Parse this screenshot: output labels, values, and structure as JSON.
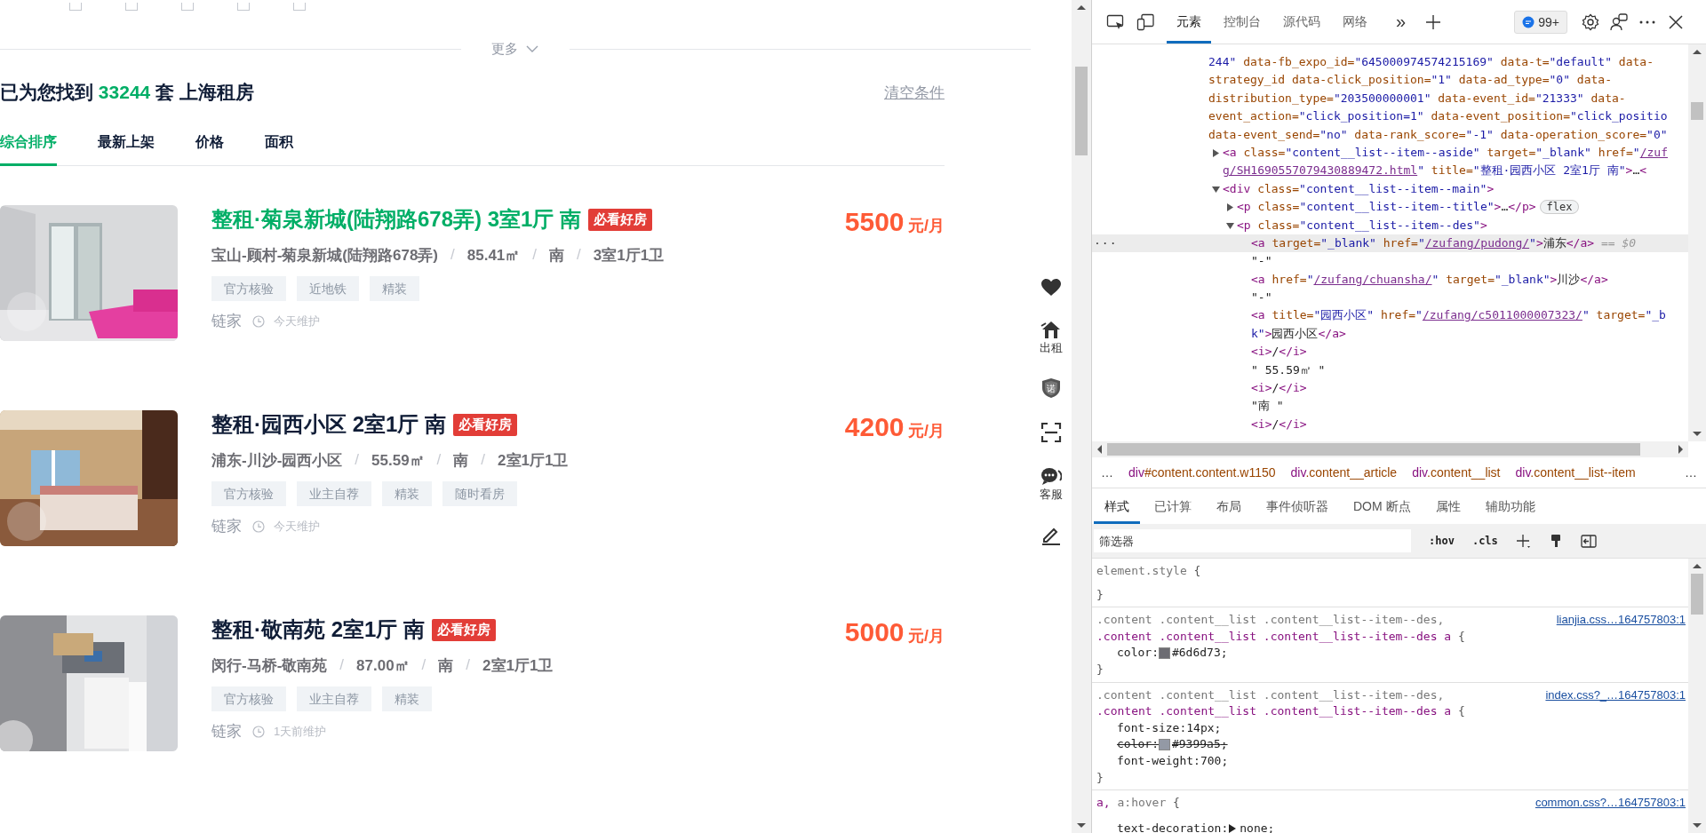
{
  "filters": [
    {
      "checked": false
    },
    {
      "checked": false
    },
    {
      "checked": false
    },
    {
      "checked": false
    },
    {
      "checked": false
    }
  ],
  "more": {
    "label": "更多"
  },
  "summary": {
    "prefix": "已为您找到",
    "count": "33244",
    "suffix": "套 上海租房"
  },
  "clear": "清空条件",
  "sort_tabs": [
    {
      "label": "综合排序",
      "selected": true
    },
    {
      "label": "最新上架",
      "selected": false
    },
    {
      "label": "价格",
      "selected": false
    },
    {
      "label": "面积",
      "selected": false
    }
  ],
  "listings": [
    {
      "picture": {
        "kind": "picture"
      },
      "title": "整租·菊泉新城(陆翔路678弄) 3室1厅 南",
      "highlighted": true,
      "badge": "必看好房",
      "price": "5500",
      "unit": "元/月",
      "details": [
        "宝山-顾村-菊泉新城(陆翔路678弄)",
        "/",
        "85.41㎡",
        "/",
        "南",
        "/",
        "3室1厅1卫"
      ],
      "tags": [
        "官方核验",
        "近地铁",
        "精装"
      ],
      "brand": "链家",
      "updated": "今天维护"
    },
    {
      "picture": {
        "kind": "picture"
      },
      "title": "整租·园西小区 2室1厅 南",
      "highlighted": false,
      "badge": "必看好房",
      "price": "4200",
      "unit": "元/月",
      "details": [
        "浦东-川沙-园西小区",
        "/",
        "55.59㎡",
        "/",
        "南",
        "/",
        "2室1厅1卫"
      ],
      "tags": [
        "官方核验",
        "业主自荐",
        "精装",
        "随时看房"
      ],
      "brand": "链家",
      "updated": "今天维护"
    },
    {
      "picture": {
        "kind": "picture"
      },
      "title": "整租·敬南苑 2室1厅 南",
      "highlighted": false,
      "badge": "必看好房",
      "price": "5000",
      "unit": "元/月",
      "details": [
        "闵行-马桥-敬南苑",
        "/",
        "87.00㎡",
        "/",
        "南",
        "/",
        "2室1厅1卫"
      ],
      "tags": [
        "官方核验",
        "业主自荐",
        "精装"
      ],
      "brand": "链家",
      "updated": "1天前维护"
    }
  ],
  "side_tools": [
    {
      "kind": "heart"
    },
    {
      "kind": "rent",
      "label": "出租"
    },
    {
      "kind": "shield",
      "glyph": "诺"
    },
    {
      "kind": "scan"
    },
    {
      "kind": "chat",
      "label": "客服"
    },
    {
      "kind": "pencil"
    }
  ],
  "devtools": {
    "tabs": [
      {
        "label": "元素",
        "selected": true
      },
      {
        "label": "控制台",
        "selected": false
      },
      {
        "label": "源代码",
        "selected": false
      },
      {
        "label": "网络",
        "selected": false
      }
    ],
    "overflow": "»",
    "issues": "99+",
    "dom": {
      "selected": false,
      "lines": [
        [
          {
            "kind": "value",
            "text": "244\""
          },
          {
            "kind": "attr",
            "text": " data-fb_expo_id="
          },
          {
            "kind": "value",
            "text": "\"645000974574215169\""
          },
          {
            "kind": "attr",
            "text": " data-t="
          },
          {
            "kind": "value",
            "text": "\"default\""
          },
          {
            "kind": "attr",
            "text": " data-"
          }
        ],
        [
          {
            "kind": "attr",
            "text": "strategy_id data-click_position="
          },
          {
            "kind": "value",
            "text": "\"1\""
          },
          {
            "kind": "attr",
            "text": " data-ad_type="
          },
          {
            "kind": "value",
            "text": "\"0\""
          },
          {
            "kind": "attr",
            "text": " data-"
          }
        ],
        [
          {
            "kind": "attr",
            "text": "distribution_type="
          },
          {
            "kind": "value",
            "text": "\"203500000001\""
          },
          {
            "kind": "attr",
            "text": " data-event_id="
          },
          {
            "kind": "value",
            "text": "\"21333\""
          },
          {
            "kind": "attr",
            "text": " data-"
          }
        ],
        [
          {
            "kind": "attr",
            "text": "event_action="
          },
          {
            "kind": "value",
            "text": "\"click_position=1\""
          },
          {
            "kind": "attr",
            "text": " data-event_position="
          },
          {
            "kind": "value",
            "text": "\"click_positio"
          }
        ],
        [
          {
            "kind": "attr",
            "text": "data-event_send="
          },
          {
            "kind": "value",
            "text": "\"no\""
          },
          {
            "kind": "attr",
            "text": " data-rank_score="
          },
          {
            "kind": "value",
            "text": "\"-1\""
          },
          {
            "kind": "attr",
            "text": " data-operation_score="
          },
          {
            "kind": "value",
            "text": "\"0\""
          }
        ]
      ],
      "children": [
        {
          "expanded": false,
          "selected": false,
          "lines": [
            [
              {
                "kind": "tag",
                "text": "<a "
              },
              {
                "kind": "attr",
                "text": "class="
              },
              {
                "kind": "value",
                "text": "\"content__list--item--aside\""
              },
              {
                "kind": "attr",
                "text": " target="
              },
              {
                "kind": "value",
                "text": "\"_blank\""
              },
              {
                "kind": "attr",
                "text": " href="
              },
              {
                "kind": "value",
                "text": "\""
              },
              {
                "kind": "link",
                "text": "/zuf"
              }
            ],
            [
              {
                "kind": "link",
                "text": "g/SH1690557079430889472.html"
              },
              {
                "kind": "value",
                "text": "\""
              },
              {
                "kind": "attr",
                "text": " title="
              },
              {
                "kind": "value",
                "text": "\"整租·园西小区 2室1厅 南\""
              },
              {
                "kind": "tag",
                "text": ">"
              },
              {
                "kind": "text",
                "text": "…"
              },
              {
                "kind": "tag",
                "text": "<"
              }
            ]
          ]
        },
        {
          "expanded": true,
          "selected": false,
          "lines": [
            [
              {
                "kind": "tag",
                "text": "<div "
              },
              {
                "kind": "attr",
                "text": "class="
              },
              {
                "kind": "value",
                "text": "\"content__list--item--main\""
              },
              {
                "kind": "tag",
                "text": ">"
              }
            ]
          ],
          "children": [
            {
              "expanded": false,
              "selected": false,
              "badge": "flex",
              "lines": [
                [
                  {
                    "kind": "tag",
                    "text": "<p "
                  },
                  {
                    "kind": "attr",
                    "text": "class="
                  },
                  {
                    "kind": "value",
                    "text": "\"content__list--item--title\""
                  },
                  {
                    "kind": "tag",
                    "text": ">"
                  },
                  {
                    "kind": "text",
                    "text": "…"
                  },
                  {
                    "kind": "tag",
                    "text": "</p>"
                  }
                ]
              ]
            },
            {
              "expanded": true,
              "selected": false,
              "lines": [
                [
                  {
                    "kind": "tag",
                    "text": "<p "
                  },
                  {
                    "kind": "attr",
                    "text": "class="
                  },
                  {
                    "kind": "value",
                    "text": "\"content__list--item--des\""
                  },
                  {
                    "kind": "tag",
                    "text": ">"
                  }
                ]
              ],
              "children": [
                {
                  "selected": true,
                  "gutter": "···",
                  "lines": [
                    [
                      {
                        "kind": "tag",
                        "text": "<a "
                      },
                      {
                        "kind": "attr",
                        "text": "target="
                      },
                      {
                        "kind": "value",
                        "text": "\"_blank\""
                      },
                      {
                        "kind": "attr",
                        "text": " href="
                      },
                      {
                        "kind": "value",
                        "text": "\""
                      },
                      {
                        "kind": "link",
                        "text": "/zufang/pudong/"
                      },
                      {
                        "kind": "value",
                        "text": "\""
                      },
                      {
                        "kind": "tag",
                        "text": ">"
                      },
                      {
                        "kind": "text",
                        "text": "浦东"
                      },
                      {
                        "kind": "tag",
                        "text": "</a>"
                      },
                      {
                        "kind": "hint",
                        "text": " == $0"
                      }
                    ]
                  ]
                },
                {
                  "selected": false,
                  "lines": [
                    [
                      {
                        "kind": "text",
                        "text": "\"-\""
                      }
                    ]
                  ]
                },
                {
                  "selected": false,
                  "lines": [
                    [
                      {
                        "kind": "tag",
                        "text": "<a "
                      },
                      {
                        "kind": "attr",
                        "text": "href="
                      },
                      {
                        "kind": "value",
                        "text": "\""
                      },
                      {
                        "kind": "link",
                        "text": "/zufang/chuansha/"
                      },
                      {
                        "kind": "value",
                        "text": "\""
                      },
                      {
                        "kind": "attr",
                        "text": " target="
                      },
                      {
                        "kind": "value",
                        "text": "\"_blank\""
                      },
                      {
                        "kind": "tag",
                        "text": ">"
                      },
                      {
                        "kind": "text",
                        "text": "川沙"
                      },
                      {
                        "kind": "tag",
                        "text": "</a>"
                      }
                    ]
                  ]
                },
                {
                  "selected": false,
                  "lines": [
                    [
                      {
                        "kind": "text",
                        "text": "\"-\""
                      }
                    ]
                  ]
                },
                {
                  "selected": false,
                  "lines": [
                    [
                      {
                        "kind": "tag",
                        "text": "<a "
                      },
                      {
                        "kind": "attr",
                        "text": "title="
                      },
                      {
                        "kind": "value",
                        "text": "\"园西小区\""
                      },
                      {
                        "kind": "attr",
                        "text": " href="
                      },
                      {
                        "kind": "value",
                        "text": "\""
                      },
                      {
                        "kind": "link",
                        "text": "/zufang/c5011000007323/"
                      },
                      {
                        "kind": "value",
                        "text": "\""
                      },
                      {
                        "kind": "attr",
                        "text": " target="
                      },
                      {
                        "kind": "value",
                        "text": "\"_b"
                      }
                    ],
                    [
                      {
                        "kind": "value",
                        "text": "k\""
                      },
                      {
                        "kind": "tag",
                        "text": ">"
                      },
                      {
                        "kind": "text",
                        "text": "园西小区"
                      },
                      {
                        "kind": "tag",
                        "text": "</a>"
                      }
                    ]
                  ]
                },
                {
                  "selected": false,
                  "lines": [
                    [
                      {
                        "kind": "tag",
                        "text": "<i>"
                      },
                      {
                        "kind": "text",
                        "text": "/"
                      },
                      {
                        "kind": "tag",
                        "text": "</i>"
                      }
                    ]
                  ]
                },
                {
                  "selected": false,
                  "lines": [
                    [
                      {
                        "kind": "text",
                        "text": "\" 55.59㎡ \""
                      }
                    ]
                  ]
                },
                {
                  "selected": false,
                  "lines": [
                    [
                      {
                        "kind": "tag",
                        "text": "<i>"
                      },
                      {
                        "kind": "text",
                        "text": "/"
                      },
                      {
                        "kind": "tag",
                        "text": "</i>"
                      }
                    ]
                  ]
                },
                {
                  "selected": false,
                  "lines": [
                    [
                      {
                        "kind": "text",
                        "text": "\"南 \""
                      }
                    ]
                  ]
                },
                {
                  "selected": false,
                  "lines": [
                    [
                      {
                        "kind": "tag",
                        "text": "<i>"
                      },
                      {
                        "kind": "text",
                        "text": "/"
                      },
                      {
                        "kind": "tag",
                        "text": "</i>"
                      }
                    ]
                  ]
                }
              ]
            }
          ]
        }
      ]
    },
    "breadcrumbs": {
      "more": "…",
      "end": "…",
      "items": [
        {
          "tag": "div",
          "rest": "#content.content.w1150"
        },
        {
          "tag": "div",
          "rest": ".content__article"
        },
        {
          "tag": "div",
          "rest": ".content__list"
        },
        {
          "tag": "div",
          "rest": ".content__list--item"
        }
      ]
    },
    "style_tabs": [
      {
        "label": "样式",
        "selected": true
      },
      {
        "label": "已计算",
        "selected": false
      },
      {
        "label": "布局",
        "selected": false
      },
      {
        "label": "事件侦听器",
        "selected": false
      },
      {
        "label": "DOM 断点",
        "selected": false
      },
      {
        "label": "属性",
        "selected": false
      },
      {
        "label": "辅助功能",
        "selected": false
      }
    ],
    "filter": {
      "placeholder": "筛选器",
      "hov": ":hov",
      "cls": ".cls"
    },
    "rules": [
      {
        "selectors": [
          [
            {
              "text": "element.style",
              "matched": false
            }
          ]
        ],
        "open": "{",
        "close": "}"
      },
      {
        "source": "lianjia.css…164757803:1",
        "selectors": [
          [
            {
              "text": ".content .content__list .content__list--item--des,",
              "matched": false
            }
          ],
          [
            {
              "text": ".content .content__list .content__list--item--des a",
              "matched": true
            }
          ]
        ],
        "open": "{",
        "props": [
          {
            "name": "color:",
            "swatch": "#6d6d73",
            "end": ";",
            "overridden": false
          }
        ],
        "close": "}"
      },
      {
        "source": "index.css?_…164757803:1",
        "selectors": [
          [
            {
              "text": ".content .content__list .content__list--item--des,",
              "matched": false
            }
          ],
          [
            {
              "text": ".content .content__list .content__list--item--des a",
              "matched": true
            }
          ]
        ],
        "open": "{",
        "props": [
          {
            "name": "font-size:",
            "value": "14px;",
            "overridden": false
          },
          {
            "name": "color:",
            "swatch": "#9399a5",
            "end": ";",
            "overridden": true
          },
          {
            "name": "font-weight:",
            "value": "700;",
            "overridden": false
          }
        ],
        "close": "}"
      },
      {
        "source": "common.css?…164757803:1",
        "selectors": [
          [
            {
              "text": "a,",
              "matched": true
            },
            {
              "text": " a:hover",
              "matched": false
            }
          ]
        ],
        "open": "{",
        "props": [
          {
            "name": "text-decoration:",
            "value": "none;",
            "expandable": true,
            "overridden": false
          }
        ]
      }
    ]
  }
}
